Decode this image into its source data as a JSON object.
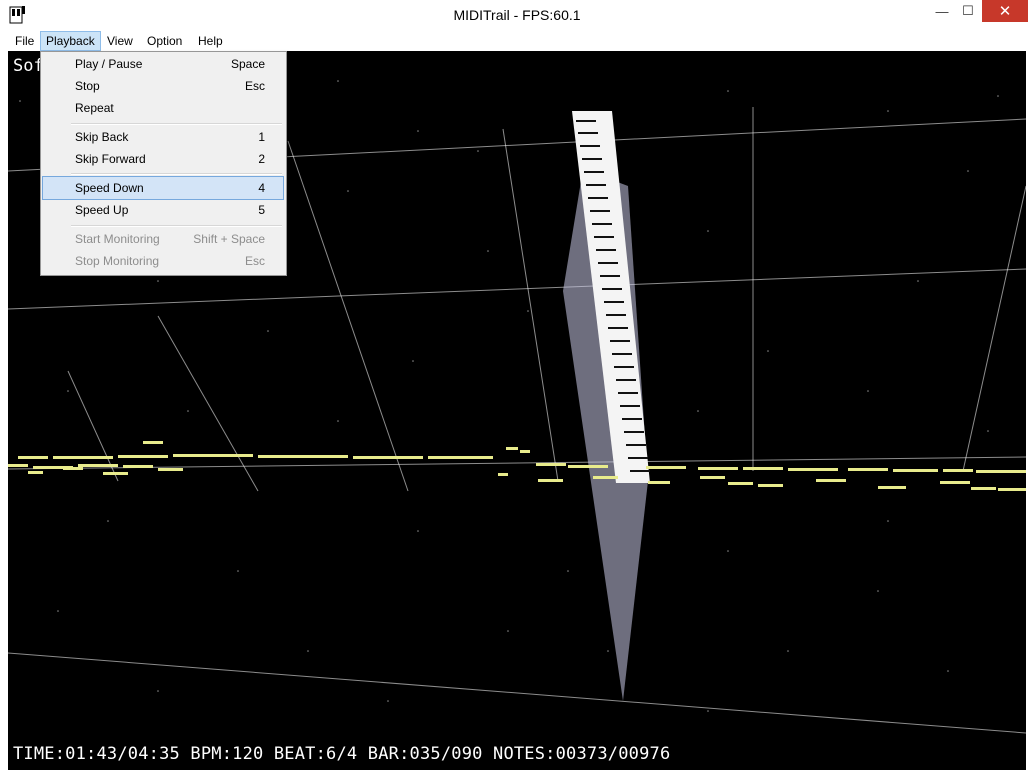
{
  "window": {
    "title": "MIDITrail - FPS:60.1",
    "minimize_glyph": "—",
    "maximize_glyph": "☐",
    "close_glyph": "✕"
  },
  "menubar": {
    "items": [
      {
        "label": "File"
      },
      {
        "label": "Playback"
      },
      {
        "label": "View"
      },
      {
        "label": "Option"
      },
      {
        "label": "Help"
      }
    ]
  },
  "playback_menu": {
    "items": [
      {
        "label": "Play / Pause",
        "shortcut": "Space"
      },
      {
        "label": "Stop",
        "shortcut": "Esc"
      },
      {
        "label": "Repeat",
        "shortcut": ""
      },
      {
        "label": "Skip Back",
        "shortcut": "1"
      },
      {
        "label": "Skip Forward",
        "shortcut": "2"
      },
      {
        "label": "Speed Down",
        "shortcut": "4"
      },
      {
        "label": "Speed Up",
        "shortcut": "5"
      },
      {
        "label": "Start Monitoring",
        "shortcut": "Shift + Space"
      },
      {
        "label": "Stop Monitoring",
        "shortcut": "Esc"
      }
    ]
  },
  "scene": {
    "song_label": "Sof",
    "status_line": "TIME:01:43/04:35 BPM:120 BEAT:6/4 BAR:035/090 NOTES:00373/00976"
  },
  "colors": {
    "background": "#000000",
    "note": "#e8eb8c",
    "menu_highlight": "#d3e4f7",
    "close_button": "#c7382a"
  }
}
